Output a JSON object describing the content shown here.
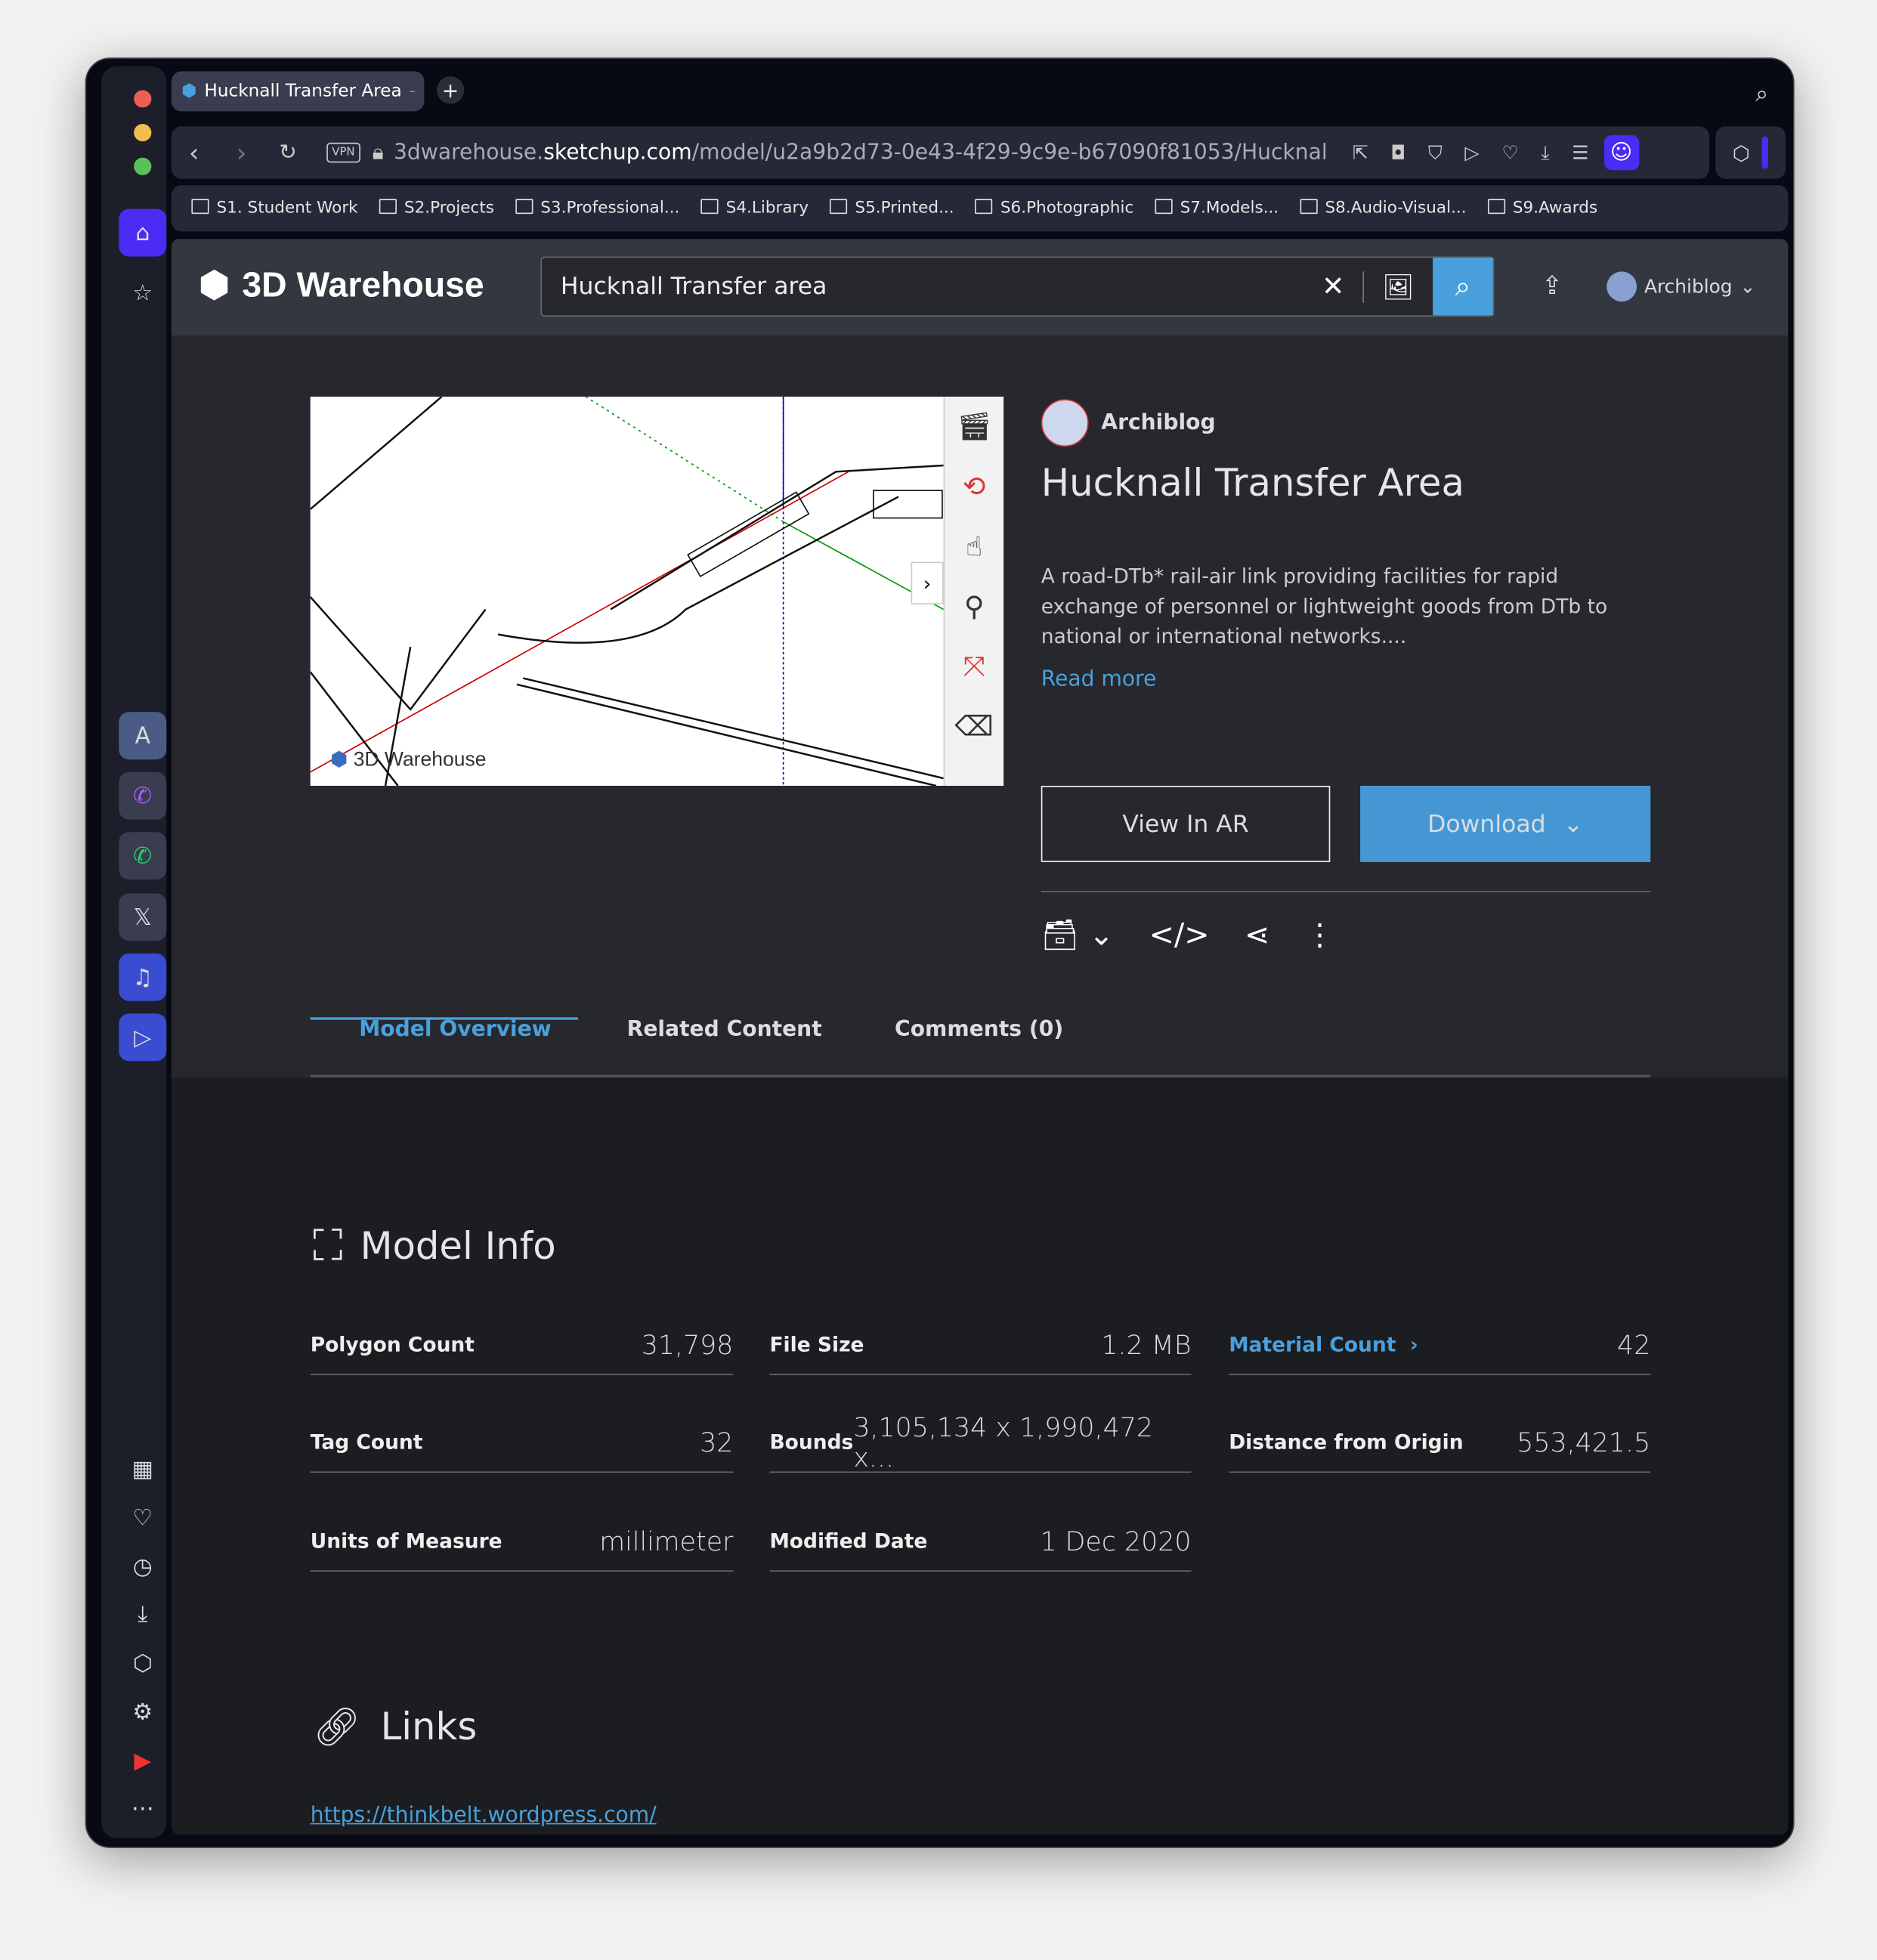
{
  "browser": {
    "tab_title": "Hucknall Transfer Area",
    "url_prefix": "3dwarehouse.",
    "url_domain": "sketchup.com",
    "url_path": "/model/u2a9b2d73-0e43-4f29-9c9e-b67090f81053/Hucknal",
    "vpn_label": "VPN",
    "bookmarks": [
      "S1. Student Work",
      "S2.Projects",
      "S3.Professional...",
      "S4.Library",
      "S5.Printed...",
      "S6.Photographic",
      "S7.Models...",
      "S8.Audio-Visual...",
      "S9.Awards"
    ],
    "colors": {
      "close": "#ec5f57",
      "minimize": "#f4bd4f",
      "maximize": "#5ac05a",
      "accent": "#4a2cf5"
    }
  },
  "header": {
    "logo": "3D Warehouse",
    "search_value": "Hucknall Transfer area",
    "user": "Archiblog"
  },
  "model": {
    "author": "Archiblog",
    "title": "Hucknall Transfer Area",
    "description": "A road-DTb* rail-air link providing facilities for rapid exchange of personnel or lightweight goods from DTb to national or international networks....",
    "read_more": "Read more",
    "view_ar": "View In AR",
    "download": "Download",
    "watermark": "3D Warehouse"
  },
  "tabs": [
    {
      "label": "Model Overview",
      "active": true
    },
    {
      "label": "Related Content"
    },
    {
      "label": "Comments (0)"
    }
  ],
  "model_info": {
    "heading": "Model Info",
    "rows": [
      {
        "key": "Polygon Count",
        "value": "31,798"
      },
      {
        "key": "File Size",
        "value": "1.2 MB"
      },
      {
        "key": "Material Count",
        "value": "42"
      },
      {
        "key": "Tag Count",
        "value": "32"
      },
      {
        "key": "Bounds",
        "value": "3,105,134 x 1,990,472 x..."
      },
      {
        "key": "Distance from Origin",
        "value": "553,421.5"
      },
      {
        "key": "Units of Measure",
        "value": "millimeter"
      },
      {
        "key": "Modified Date",
        "value": "1 Dec 2020"
      }
    ]
  },
  "links": {
    "heading": "Links",
    "url": "https://thinkbelt.wordpress.com/"
  },
  "accent": "#4aa0dc"
}
